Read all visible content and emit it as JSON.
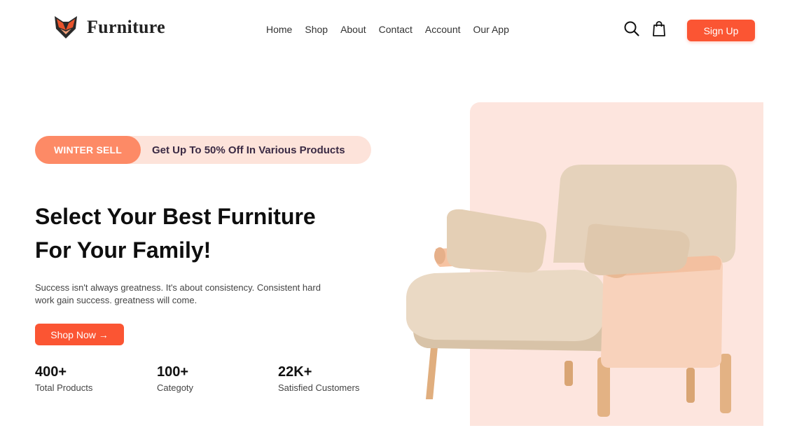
{
  "brand": {
    "name": "Furniture",
    "logo_icon": "fox-logo-icon"
  },
  "nav": {
    "items": [
      {
        "label": "Home"
      },
      {
        "label": "Shop"
      },
      {
        "label": "About"
      },
      {
        "label": "Contact"
      },
      {
        "label": "Account"
      },
      {
        "label": "Our App"
      }
    ]
  },
  "header_actions": {
    "search_icon": "search-icon",
    "cart_icon": "shopping-bag-icon",
    "signup_label": "Sign Up"
  },
  "promo": {
    "tag": "WINTER SELL",
    "text": "Get Up To 50% Off In Various Products"
  },
  "hero": {
    "headline_line1": "Select Your Best Furniture",
    "headline_line2": "For Your Family!",
    "description": "Success isn't always greatness. It's about consistency. Consistent hard work gain success. greatness will come.",
    "cta_label": "Shop Now →",
    "image": "armchair-image"
  },
  "stats": [
    {
      "value": "400+",
      "label": "Total Products"
    },
    {
      "value": "100+",
      "label": "Categoty"
    },
    {
      "value": "22K+",
      "label": "Satisfied Customers"
    }
  ],
  "colors": {
    "accent": "#fb5533",
    "promo_tag": "#fd8a66",
    "promo_bg": "#fde3da",
    "hero_bg": "#fde5de"
  }
}
